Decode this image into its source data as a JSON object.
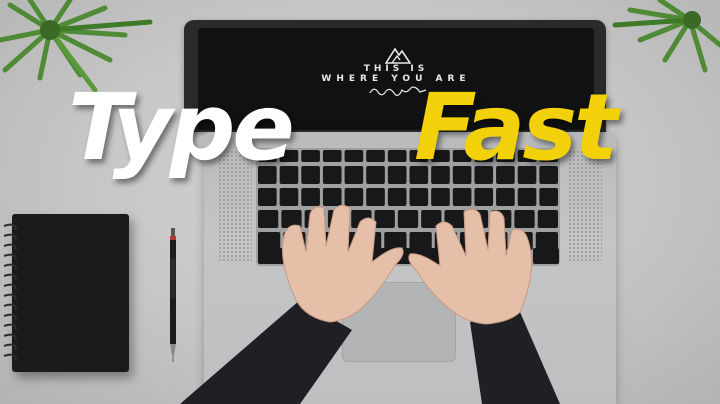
{
  "headline": {
    "word_1": "Type",
    "word_2": "Fast",
    "word_1_color": "#ffffff",
    "word_2_color": "#f2d10a"
  },
  "laptop_screen": {
    "line_1": "THIS IS",
    "line_2": "WHERE YOU ARE"
  },
  "colors": {
    "background": "#c9c9c9",
    "laptop_body": "#bdbec0",
    "laptop_lid": "#2a2a2c",
    "notebook": "#1b1b1b",
    "sleeve": "#1e2024",
    "skin": "#e6bfa8",
    "plant_leaf": "#4f8a34"
  },
  "icons": [
    "mountain-logo-icon",
    "signature-icon"
  ]
}
